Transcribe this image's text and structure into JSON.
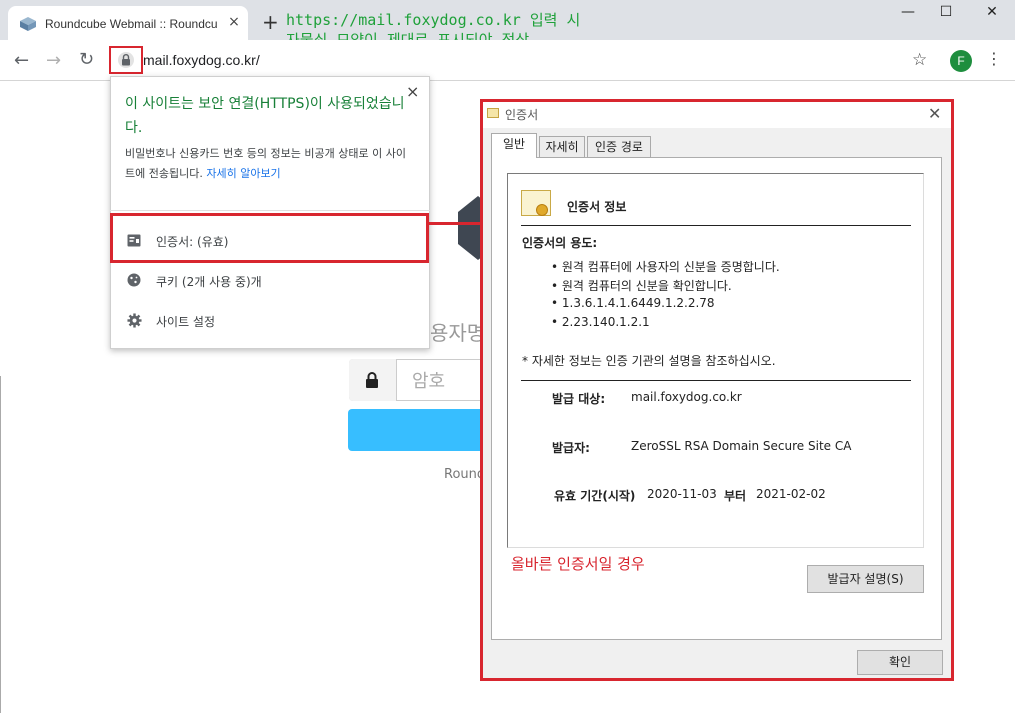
{
  "browser": {
    "tab_title": "Roundcube Webmail :: Roundcube",
    "tab_close": "×",
    "new_tab": "+",
    "url": "mail.foxydog.co.kr/",
    "profile_initial": "F",
    "window_controls": {
      "minimize": "—",
      "maximize": "☐",
      "close": "✕"
    },
    "nav": {
      "back": "←",
      "forward": "→",
      "reload": "↻"
    },
    "bookmark_icon": "☆",
    "menu_icon": "⋮"
  },
  "annotation": {
    "line1": "https://mail.foxydog.co.kr 입력 시",
    "line2": "자물쇠 모양이 제대로 표시되야 정상",
    "color": "#1fa13a"
  },
  "background_page": {
    "username_fragment": "용자명",
    "password_placeholder": "암호",
    "footer_fragment": "Roundc"
  },
  "site_info_popup": {
    "title": "이 사이트는 보안 연결(HTTPS)이 사용되었습니다.",
    "description": "비밀번호나 신용카드 번호 등의 정보는 비공개 상태로 이 사이트에 전송됩니다.",
    "learn_more": "자세히 알아보기",
    "close": "×",
    "items": [
      {
        "icon": "certificate-icon",
        "label": "인증서: (유효)"
      },
      {
        "icon": "cookie-icon",
        "label": "쿠키 (2개 사용 중)개"
      },
      {
        "icon": "gear-icon",
        "label": "사이트 설정"
      }
    ]
  },
  "certificate_dialog": {
    "title": "인증서",
    "close": "✕",
    "tabs": [
      "일반",
      "자세히",
      "인증 경로"
    ],
    "heading": "인증서 정보",
    "purpose_label": "인증서의 용도:",
    "purposes": [
      "• 원격 컴퓨터에 사용자의 신분을 증명합니다.",
      "• 원격 컴퓨터의 신분을 확인합니다.",
      "• 1.3.6.1.4.1.6449.1.2.2.78",
      "• 2.23.140.1.2.1"
    ],
    "note": "* 자세한 정보는 인증 기관의 설명을 참조하십시오.",
    "issued_to_label": "발급 대상:",
    "issued_to": "mail.foxydog.co.kr",
    "issued_by_label": "발급자:",
    "issued_by": "ZeroSSL RSA Domain Secure Site CA",
    "validity_label": "유효 기간(시작)",
    "valid_from": "2020-11-03",
    "valid_to_label": "부터",
    "valid_to": "2021-02-02",
    "issuer_statement_button": "발급자 설명(S)",
    "ok_button": "확인"
  },
  "note_label": "올바른 인증서일 경우",
  "highlight_color": "#d8262f"
}
